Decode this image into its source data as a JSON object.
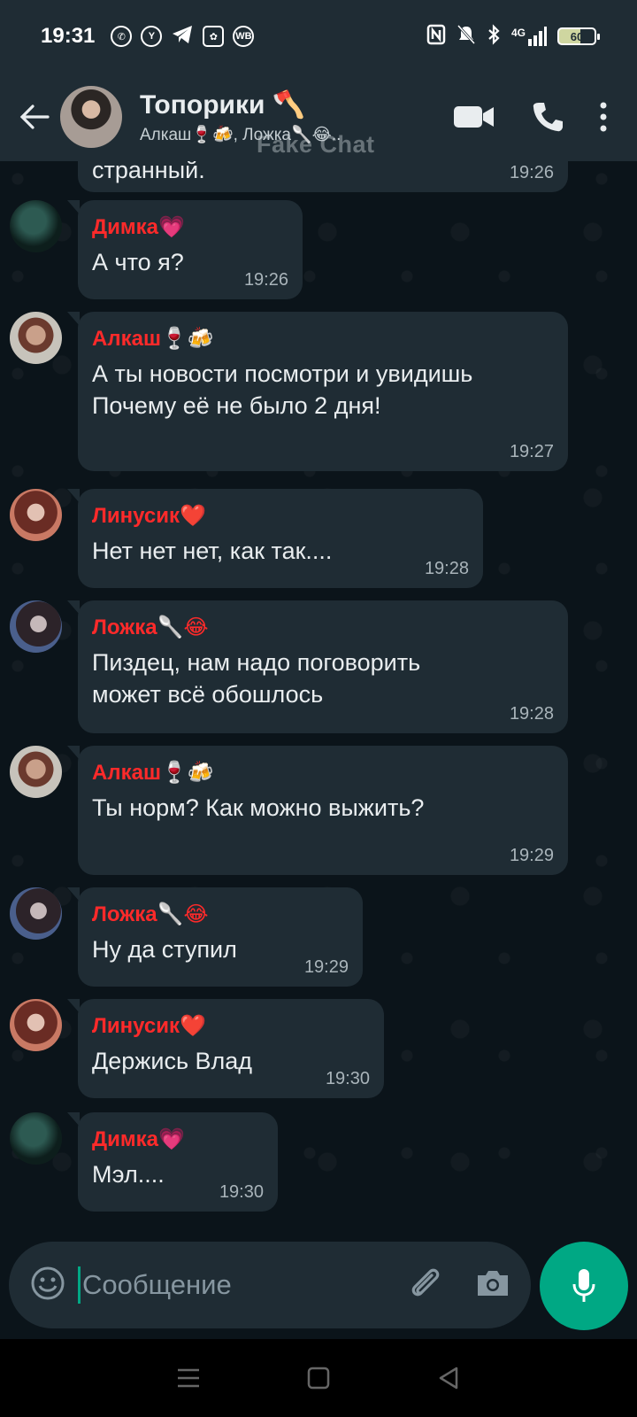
{
  "status_bar": {
    "time": "19:31",
    "app_icons": [
      "whatsapp-icon",
      "yandex-icon",
      "telegram-icon",
      "gallery-icon",
      "wb-icon"
    ],
    "wb_label": "WB",
    "network": "4G",
    "battery": "60"
  },
  "header": {
    "title": "Топорики 🪓",
    "subtitle": "Алкаш🍷🍻, Ложка🥄😂..",
    "watermark": "Fake Chat"
  },
  "messages": [
    {
      "sender": "",
      "text": "странный.",
      "time": "19:26",
      "avatar": "none"
    },
    {
      "sender": "Димка💗",
      "text": "А что я?",
      "time": "19:26",
      "avatar": "dimka"
    },
    {
      "sender": "Алкаш🍷🍻",
      "text": "А ты новости посмотри и увидишь\nПочему её не было 2 дня!",
      "time": "19:27",
      "avatar": "alkash"
    },
    {
      "sender": "Линусик❤️",
      "text": "Нет нет нет, как так....",
      "time": "19:28",
      "avatar": "linus"
    },
    {
      "sender": "Ложка🥄😂",
      "text": "Пиздец, нам надо поговорить\nможет всё обошлось",
      "time": "19:28",
      "avatar": "lozhka"
    },
    {
      "sender": "Алкаш🍷🍻",
      "text": "Ты норм? Как можно выжить?",
      "time": "19:29",
      "avatar": "alkash"
    },
    {
      "sender": "Ложка🥄😂",
      "text": "Ну да ступил",
      "time": "19:29",
      "avatar": "lozhka"
    },
    {
      "sender": "Линусик❤️",
      "text": "Держись Влад",
      "time": "19:30",
      "avatar": "linus"
    },
    {
      "sender": "Димка💗",
      "text": "Мэл....",
      "time": "19:30",
      "avatar": "dimka"
    }
  ],
  "composer": {
    "placeholder": "Сообщение"
  },
  "colors": {
    "accent": "#00a884",
    "sender_name": "#ff2a2a",
    "bubble": "#1f2c34",
    "background": "#0b141a"
  }
}
